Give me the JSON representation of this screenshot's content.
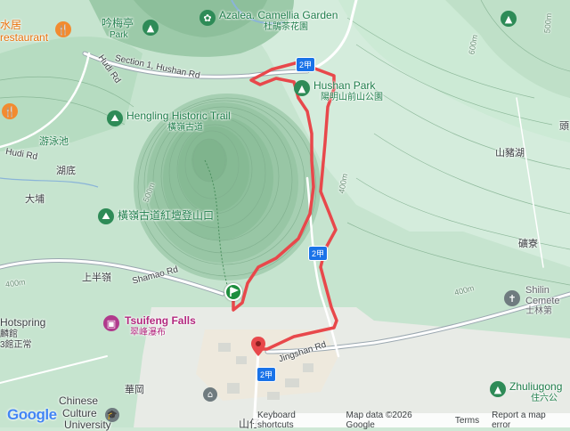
{
  "map": {
    "pois": [
      {
        "name": "陽明山前山公園-poi",
        "label": "Hushan Park",
        "sub": "陽明山前山公園"
      },
      {
        "name": "azalea-garden",
        "label": "Azalea. Camellia Garden",
        "sub": "杜鵑茶花園"
      },
      {
        "name": "yinmei-pavilion",
        "label": "吟梅亭",
        "sub": "Park"
      },
      {
        "name": "hengling-trail",
        "label": "Hengling Historic Trail",
        "sub": "橫嶺古道"
      },
      {
        "name": "hengling-entrance",
        "label": "橫嶺古道紅壇登山口"
      },
      {
        "name": "tsuifeng-falls",
        "label": "Tsuifeng Falls",
        "sub": "翠峰瀑布"
      },
      {
        "name": "shilin-cemetery",
        "label": "Shilin",
        "sub": "Cemete",
        "sub2": "士林第"
      },
      {
        "name": "zhuliugong",
        "label": "Zhuliugong",
        "sub": "住六公"
      },
      {
        "name": "restaurant",
        "label": "restaurant",
        "sub": "水居"
      }
    ],
    "places": [
      "游泳池",
      "湖底",
      "大埔",
      "上半嶺",
      "山豬湖",
      "礦寮",
      "頭",
      "華岡",
      "Chinese",
      "Culture",
      "University",
      "Hotspring",
      "麟館",
      "3館正常",
      "山仔"
    ],
    "roads": [
      "Section 1, Hushan Rd",
      "Hudi Rd",
      "Hudi Rd",
      "Shamao Rd",
      "Jingshan Rd",
      "2甲",
      "2甲",
      "2甲"
    ],
    "elevations": [
      "500m",
      "400m",
      "400m",
      "500m",
      "500m",
      "400m",
      "400m",
      "600m"
    ],
    "hotspring_lines": [
      "Hotspring",
      "麟館(二館",
      "3館正常…"
    ]
  },
  "footer": {
    "logo": "Google",
    "keyboard": "Keyboard shortcuts",
    "mapdata": "Map data ©2026 Google",
    "terms": "Terms",
    "report": "Report a map error"
  }
}
